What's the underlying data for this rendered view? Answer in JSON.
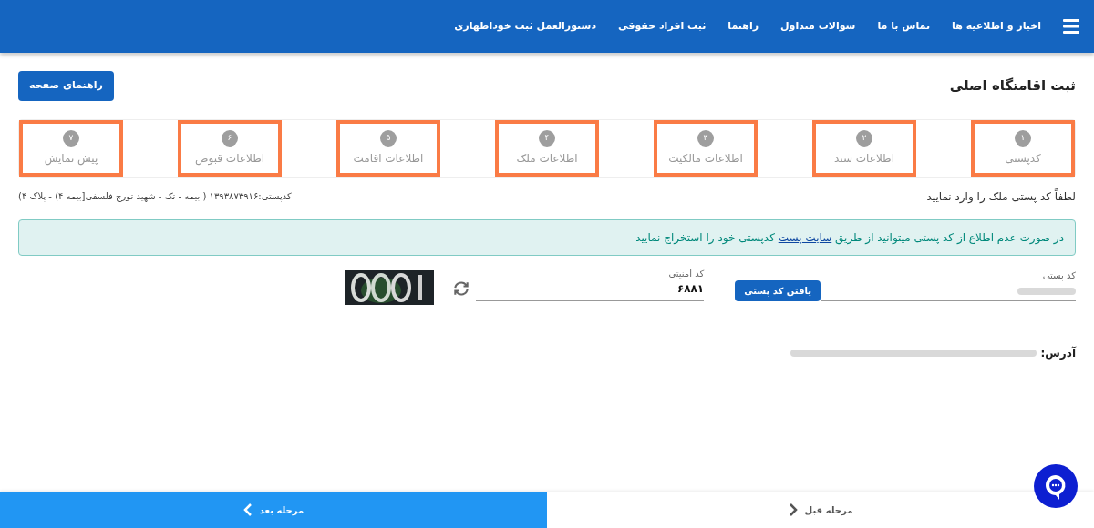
{
  "nav": {
    "items": [
      "اخبار و اطلاعیه ها",
      "تماس با ما",
      "سوالات متداول",
      "راهنما",
      "ثبت افراد حقوقی",
      "دستورالعمل ثبت خوداظهاری"
    ]
  },
  "page": {
    "title": "ثبت اقامتگاه اصلی",
    "help_button": "راهنمای صفحه"
  },
  "steps": [
    {
      "number": "۱",
      "label": "کدپستی"
    },
    {
      "number": "۲",
      "label": "اطلاعات سند"
    },
    {
      "number": "۳",
      "label": "اطلاعات مالکیت"
    },
    {
      "number": "۴",
      "label": "اطلاعات ملک"
    },
    {
      "number": "۵",
      "label": "اطلاعات اقامت"
    },
    {
      "number": "۶",
      "label": "اطلاعات قبوض"
    },
    {
      "number": "۷",
      "label": "پیش نمایش"
    }
  ],
  "instruction": "لطفاً کد پستی ملک را وارد نمایید",
  "postal_summary": "کدپستی:۱۳۹۳۸۷۳۹۱۶ ( بیمه - تک - شهید تورج فلسفی[بیمه ۴) - پلاک ۴)",
  "alert": {
    "before": "در صورت عدم اطلاع از کد پستی میتوانید از طریق",
    "link": "سایت پست",
    "after": "کدپستی خود را استخراج نمایید"
  },
  "postal_code": {
    "label": "کد پستی",
    "find_button": "یافتن کد پستی"
  },
  "security_code": {
    "label": "کد امنیتی",
    "value": "۶۸۸۱"
  },
  "address": {
    "label": "آدرس:"
  },
  "footer": {
    "previous": "مرحله قبل",
    "next": "مرحله بعد"
  }
}
